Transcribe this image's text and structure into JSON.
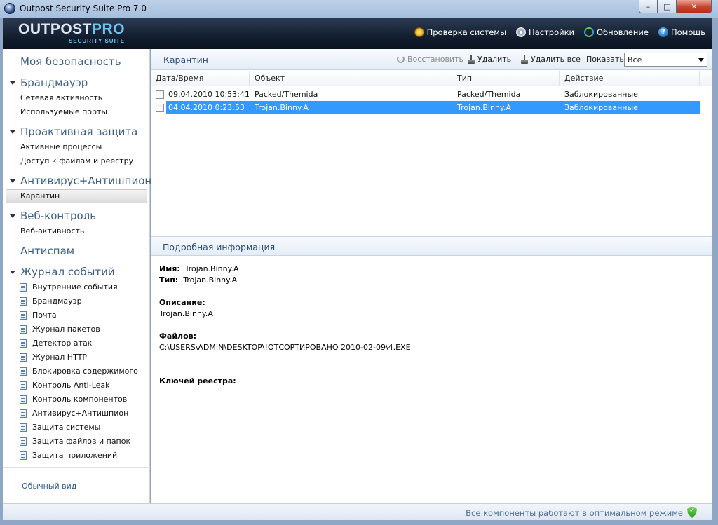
{
  "window": {
    "title": "Outpost Security Suite Pro 7.0",
    "min": "–",
    "max": "□",
    "close": "✕"
  },
  "logo": {
    "line1a": "OUTPOST",
    "line1b": "PRO",
    "line2": "SECURITY SUITE"
  },
  "topnav": [
    {
      "label": "Проверка системы",
      "icon": "star-icon"
    },
    {
      "label": "Настройки",
      "icon": "gear-icon"
    },
    {
      "label": "Обновление",
      "icon": "update-icon"
    },
    {
      "label": "Помощь",
      "icon": "help-icon"
    }
  ],
  "sidebar": {
    "my_security": "Моя безопасность",
    "firewall": {
      "title": "Брандмауэр",
      "items": [
        "Сетевая активность",
        "Используемые порты"
      ]
    },
    "proactive": {
      "title": "Проактивная защита",
      "items": [
        "Активные процессы",
        "Доступ к файлам и реестру"
      ]
    },
    "antivirus": {
      "title": "Антивирус+Антишпион",
      "items": [
        "Карантин"
      ]
    },
    "webcontrol": {
      "title": "Веб-контроль",
      "items": [
        "Веб-активность"
      ]
    },
    "antispam": "Антиспам",
    "eventlog": {
      "title": "Журнал событий",
      "items": [
        "Внутренние события",
        "Брандмауэр",
        "Почта",
        "Журнал пакетов",
        "Детектор атак",
        "Журнал HTTP",
        "Блокировка содержимого",
        "Контроль Anti-Leak",
        "Контроль компонентов",
        "Антивирус+Антишпион",
        "Защита системы",
        "Защита файлов и папок",
        "Защита приложений"
      ]
    },
    "ordinary_view": "Обычный вид"
  },
  "toolbar": {
    "title": "Карантин",
    "restore": "Восстановить",
    "delete": "Удалить",
    "delete_all": "Удалить все",
    "show_label": "Показать:",
    "show_value": "Все"
  },
  "table": {
    "columns": [
      "Дата/Время",
      "Объект",
      "Тип",
      "Действие"
    ],
    "rows": [
      {
        "datetime": "09.04.2010 10:53:41",
        "object": "Packed/Themida",
        "type": "Packed/Themida",
        "action": "Заблокированные",
        "selected": false
      },
      {
        "datetime": "04.04.2010 0:23:53",
        "object": "Trojan.Binny.A",
        "type": "Trojan.Binny.A",
        "action": "Заблокированные",
        "selected": true
      }
    ]
  },
  "details": {
    "title": "Подробная информация",
    "name_label": "Имя:",
    "name_value": "Trojan.Binny.A",
    "type_label": "Тип:",
    "type_value": "Trojan.Binny.A",
    "desc_label": "Описание:",
    "desc_value": "Trojan.Binny.A",
    "files_label": "Файлов:",
    "files_value": "C:\\USERS\\ADMIN\\DESKTOP\\!ОТСОРТИРОВАНО 2010-02-09\\4.EXE",
    "registry_label": "Ключей реестра:"
  },
  "status": {
    "text": "Все компоненты работают в оптимальном режиме"
  },
  "colors": {
    "accent": "#3399ff",
    "header_bg": "#0f1a2a",
    "section_text": "#3b5f86"
  }
}
